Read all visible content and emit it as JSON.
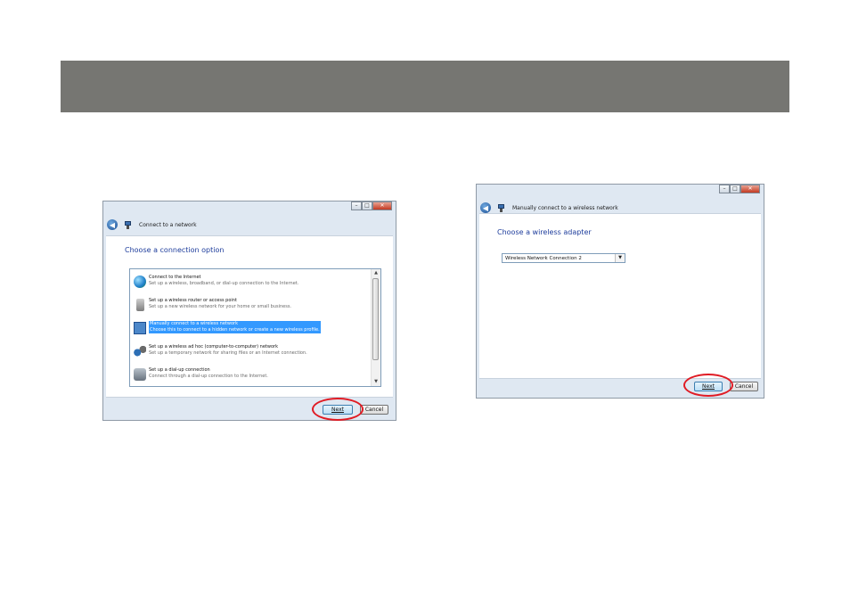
{
  "window1": {
    "title": "Connect to a network",
    "heading": "Choose a connection option",
    "options": [
      {
        "title": "Connect to the Internet",
        "desc": "Set up a wireless, broadband, or dial-up connection to the Internet.",
        "icon": "globe-icon"
      },
      {
        "title": "Set up a wireless router or access point",
        "desc": "Set up a new wireless network for your home or small business.",
        "icon": "router-icon"
      },
      {
        "title": "Manually connect to a wireless network",
        "desc": "Choose this to connect to a hidden network or create a new wireless profile.",
        "icon": "monitor-network-icon",
        "selected": true
      },
      {
        "title": "Set up a wireless ad hoc (computer-to-computer) network",
        "desc": "Set up a temporary network for sharing files or an Internet connection.",
        "icon": "adhoc-network-icon"
      },
      {
        "title": "Set up a dial-up connection",
        "desc": "Connect through a dial-up connection to the Internet.",
        "icon": "phone-icon"
      }
    ],
    "next_label": "Next",
    "cancel_label": "Cancel"
  },
  "window2": {
    "title": "Manually connect to a wireless network",
    "heading": "Choose a wireless adapter",
    "adapter_selected": "Wireless Network Connection 2",
    "next_label": "Next",
    "cancel_label": "Cancel"
  },
  "colors": {
    "banner": "#767672",
    "heading": "#1e3d9c",
    "selection": "#3399ff",
    "highlight_ring": "#e01b24"
  }
}
